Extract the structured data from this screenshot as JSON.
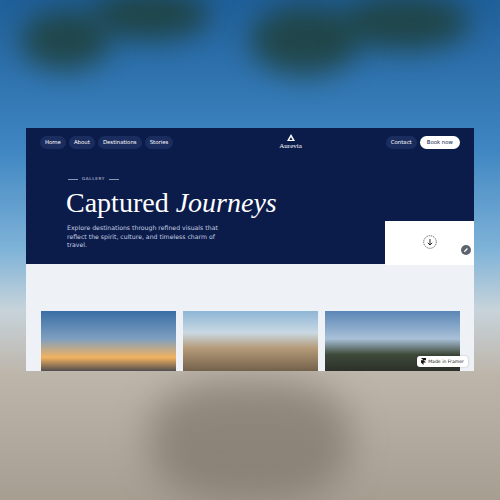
{
  "nav": {
    "links": [
      {
        "label": "Home"
      },
      {
        "label": "About"
      },
      {
        "label": "Destinations"
      },
      {
        "label": "Stories"
      }
    ],
    "logo": "Aurevia",
    "actions": [
      {
        "label": "Contact",
        "kind": "secondary"
      },
      {
        "label": "Book now",
        "kind": "primary"
      }
    ]
  },
  "hero": {
    "eyebrow": "GALLERY",
    "title_plain": "Captured",
    "title_italic": "Journeys",
    "description": "Explore destinations through refined visuals that reflect the spirit, culture, and timeless charm of travel."
  },
  "badge": "Made in Framer"
}
